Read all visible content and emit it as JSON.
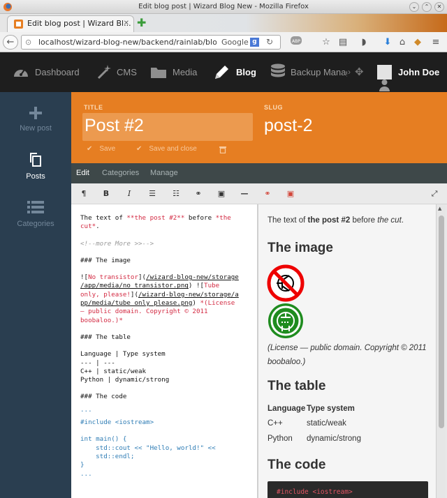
{
  "window": {
    "title": "Edit blog post | Wizard Blog New - Mozilla Firefox"
  },
  "browser": {
    "tab_title": "Edit blog post | Wizard Bl...",
    "url": "localhost/wizard-blog-new/backend/rainlab/blog/po",
    "search_engine": "Google"
  },
  "nav": {
    "items": [
      {
        "label": "Dashboard",
        "icon": "dashboard-icon"
      },
      {
        "label": "CMS",
        "icon": "magic-wand-icon"
      },
      {
        "label": "Media",
        "icon": "folder-icon"
      },
      {
        "label": "Blog",
        "icon": "pencil-icon"
      },
      {
        "label": "Backup Manag",
        "icon": "database-icon"
      }
    ],
    "user": "John Doe"
  },
  "sidebar": {
    "items": [
      {
        "label": "New post",
        "icon": "plus-icon"
      },
      {
        "label": "Posts",
        "icon": "copy-icon"
      },
      {
        "label": "Categories",
        "icon": "list-icon"
      }
    ]
  },
  "form": {
    "title_label": "TITLE",
    "title_value": "Post #2",
    "slug_label": "SLUG",
    "slug_value": "post-2",
    "save_label": "Save",
    "save_close_label": "Save and close"
  },
  "tabs": [
    "Edit",
    "Categories",
    "Manage"
  ],
  "toolbar": {
    "paragraph": "¶",
    "bold": "B",
    "italic": "I"
  },
  "editor": {
    "line1a": "The text of ",
    "line1b": "**the post #2**",
    "line1c": " before ",
    "line1d": "*the",
    "line2a": "cut*",
    "line2b": ".",
    "more": "<!--more More >>-->",
    "h_image": "### The image",
    "img1a": "![",
    "img1b": "No transistor",
    "img1c": "](",
    "img1d": "/wizard-blog-new/storage",
    "img2": "/app/media/no_transistor.png",
    "img2b": ") ![",
    "img2c": "Tube",
    "img3a": "only, please!",
    "img3b": "](",
    "img3c": "/wizard-blog-new/storage/a",
    "img4a": "pp/media/tube_only_please.png",
    "img4b": ") ",
    "img4c": "*(License",
    "img5": "— public domain. Copyright © 2011",
    "img6": "boobaloo.)*",
    "h_table": "### The table",
    "t1": "Language | Type system",
    "t2": "--- | ---",
    "t3": "C++ | static/weak",
    "t4": "Python | dynamic/strong",
    "h_code": "### The code",
    "c0": "...",
    "c1": "#include <iostream>",
    "c2": "int main() {",
    "c3": "    std::cout << \"Hello, world!\" <<",
    "c4": "    std::endl;",
    "c5": "}",
    "c6": "..."
  },
  "preview": {
    "p1a": "The text of ",
    "p1b": "the post #2",
    "p1c": " before ",
    "p1d": "the cut",
    "p1e": ".",
    "h_image": "The image",
    "license": "(License — public domain. Copyright © 2011 boobaloo.)",
    "h_table": "The table",
    "table_head": [
      "Language",
      "Type system"
    ],
    "table_rows": [
      [
        "C++",
        "static/weak"
      ],
      [
        "Python",
        "dynamic/strong"
      ]
    ],
    "h_code": "The code",
    "code": "#include <iostream>"
  },
  "colors": {
    "orange": "#e67e22",
    "sidebar": "#2a3e50",
    "header": "#1e1e1e",
    "code_red": "#d32b43",
    "code_blue": "#2f7db5"
  }
}
